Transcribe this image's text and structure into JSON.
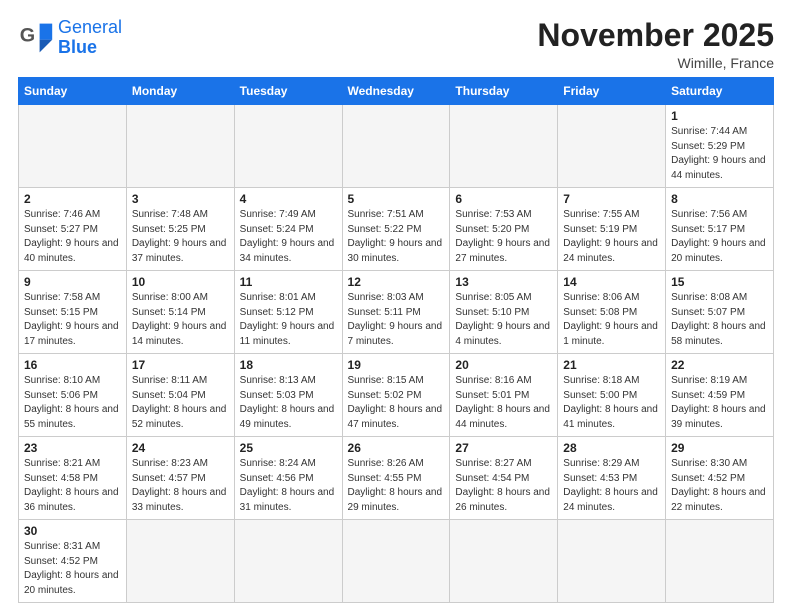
{
  "header": {
    "logo_general": "General",
    "logo_blue": "Blue",
    "month_title": "November 2025",
    "location": "Wimille, France"
  },
  "days_of_week": [
    "Sunday",
    "Monday",
    "Tuesday",
    "Wednesday",
    "Thursday",
    "Friday",
    "Saturday"
  ],
  "weeks": [
    [
      {
        "num": "",
        "info": ""
      },
      {
        "num": "",
        "info": ""
      },
      {
        "num": "",
        "info": ""
      },
      {
        "num": "",
        "info": ""
      },
      {
        "num": "",
        "info": ""
      },
      {
        "num": "",
        "info": ""
      },
      {
        "num": "1",
        "info": "Sunrise: 7:44 AM\nSunset: 5:29 PM\nDaylight: 9 hours\nand 44 minutes."
      }
    ],
    [
      {
        "num": "2",
        "info": "Sunrise: 7:46 AM\nSunset: 5:27 PM\nDaylight: 9 hours\nand 40 minutes."
      },
      {
        "num": "3",
        "info": "Sunrise: 7:48 AM\nSunset: 5:25 PM\nDaylight: 9 hours\nand 37 minutes."
      },
      {
        "num": "4",
        "info": "Sunrise: 7:49 AM\nSunset: 5:24 PM\nDaylight: 9 hours\nand 34 minutes."
      },
      {
        "num": "5",
        "info": "Sunrise: 7:51 AM\nSunset: 5:22 PM\nDaylight: 9 hours\nand 30 minutes."
      },
      {
        "num": "6",
        "info": "Sunrise: 7:53 AM\nSunset: 5:20 PM\nDaylight: 9 hours\nand 27 minutes."
      },
      {
        "num": "7",
        "info": "Sunrise: 7:55 AM\nSunset: 5:19 PM\nDaylight: 9 hours\nand 24 minutes."
      },
      {
        "num": "8",
        "info": "Sunrise: 7:56 AM\nSunset: 5:17 PM\nDaylight: 9 hours\nand 20 minutes."
      }
    ],
    [
      {
        "num": "9",
        "info": "Sunrise: 7:58 AM\nSunset: 5:15 PM\nDaylight: 9 hours\nand 17 minutes."
      },
      {
        "num": "10",
        "info": "Sunrise: 8:00 AM\nSunset: 5:14 PM\nDaylight: 9 hours\nand 14 minutes."
      },
      {
        "num": "11",
        "info": "Sunrise: 8:01 AM\nSunset: 5:12 PM\nDaylight: 9 hours\nand 11 minutes."
      },
      {
        "num": "12",
        "info": "Sunrise: 8:03 AM\nSunset: 5:11 PM\nDaylight: 9 hours\nand 7 minutes."
      },
      {
        "num": "13",
        "info": "Sunrise: 8:05 AM\nSunset: 5:10 PM\nDaylight: 9 hours\nand 4 minutes."
      },
      {
        "num": "14",
        "info": "Sunrise: 8:06 AM\nSunset: 5:08 PM\nDaylight: 9 hours\nand 1 minute."
      },
      {
        "num": "15",
        "info": "Sunrise: 8:08 AM\nSunset: 5:07 PM\nDaylight: 8 hours\nand 58 minutes."
      }
    ],
    [
      {
        "num": "16",
        "info": "Sunrise: 8:10 AM\nSunset: 5:06 PM\nDaylight: 8 hours\nand 55 minutes."
      },
      {
        "num": "17",
        "info": "Sunrise: 8:11 AM\nSunset: 5:04 PM\nDaylight: 8 hours\nand 52 minutes."
      },
      {
        "num": "18",
        "info": "Sunrise: 8:13 AM\nSunset: 5:03 PM\nDaylight: 8 hours\nand 49 minutes."
      },
      {
        "num": "19",
        "info": "Sunrise: 8:15 AM\nSunset: 5:02 PM\nDaylight: 8 hours\nand 47 minutes."
      },
      {
        "num": "20",
        "info": "Sunrise: 8:16 AM\nSunset: 5:01 PM\nDaylight: 8 hours\nand 44 minutes."
      },
      {
        "num": "21",
        "info": "Sunrise: 8:18 AM\nSunset: 5:00 PM\nDaylight: 8 hours\nand 41 minutes."
      },
      {
        "num": "22",
        "info": "Sunrise: 8:19 AM\nSunset: 4:59 PM\nDaylight: 8 hours\nand 39 minutes."
      }
    ],
    [
      {
        "num": "23",
        "info": "Sunrise: 8:21 AM\nSunset: 4:58 PM\nDaylight: 8 hours\nand 36 minutes."
      },
      {
        "num": "24",
        "info": "Sunrise: 8:23 AM\nSunset: 4:57 PM\nDaylight: 8 hours\nand 33 minutes."
      },
      {
        "num": "25",
        "info": "Sunrise: 8:24 AM\nSunset: 4:56 PM\nDaylight: 8 hours\nand 31 minutes."
      },
      {
        "num": "26",
        "info": "Sunrise: 8:26 AM\nSunset: 4:55 PM\nDaylight: 8 hours\nand 29 minutes."
      },
      {
        "num": "27",
        "info": "Sunrise: 8:27 AM\nSunset: 4:54 PM\nDaylight: 8 hours\nand 26 minutes."
      },
      {
        "num": "28",
        "info": "Sunrise: 8:29 AM\nSunset: 4:53 PM\nDaylight: 8 hours\nand 24 minutes."
      },
      {
        "num": "29",
        "info": "Sunrise: 8:30 AM\nSunset: 4:52 PM\nDaylight: 8 hours\nand 22 minutes."
      }
    ],
    [
      {
        "num": "30",
        "info": "Sunrise: 8:31 AM\nSunset: 4:52 PM\nDaylight: 8 hours\nand 20 minutes."
      },
      {
        "num": "",
        "info": ""
      },
      {
        "num": "",
        "info": ""
      },
      {
        "num": "",
        "info": ""
      },
      {
        "num": "",
        "info": ""
      },
      {
        "num": "",
        "info": ""
      },
      {
        "num": "",
        "info": ""
      }
    ]
  ]
}
